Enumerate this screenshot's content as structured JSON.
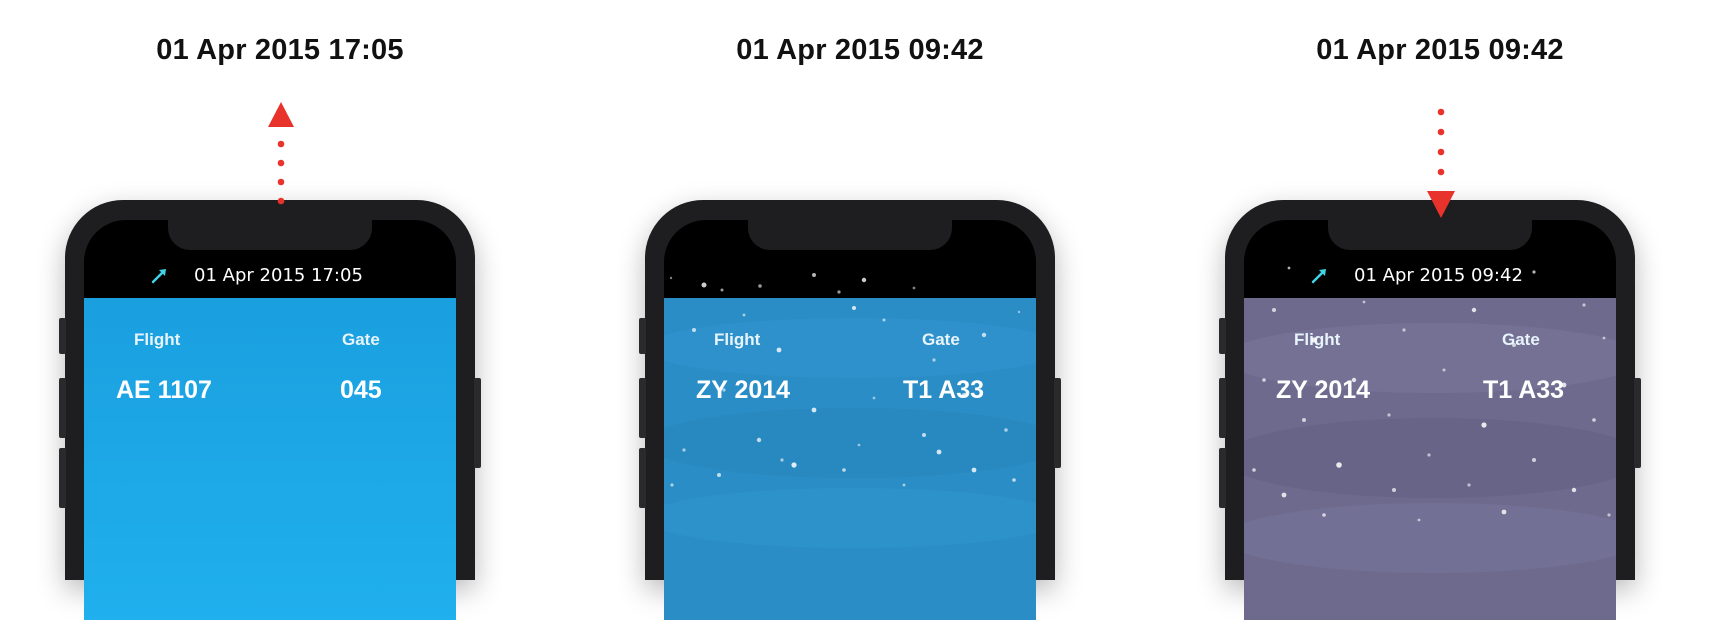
{
  "panels": [
    {
      "caption": "01 Apr 2015 17:05",
      "status_time": "01 Apr 2015 17:05",
      "flight_label": "Flight",
      "gate_label": "Gate",
      "flight_number": "AE 1107",
      "gate_number": "045",
      "background": "#1aa3e3",
      "arrow": "up",
      "plane_icon": "plane-icon"
    },
    {
      "caption": "01 Apr 2015 09:42",
      "status_time": "",
      "flight_label": "Flight",
      "gate_label": "Gate",
      "flight_number": "ZY 2014",
      "gate_number": "T1 A33",
      "background": "#2b8dc5",
      "arrow": "none",
      "weather": "snow"
    },
    {
      "caption": "01 Apr 2015 09:42",
      "status_time": "01 Apr 2015 09:42",
      "flight_label": "Flight",
      "gate_label": "Gate",
      "flight_number": "ZY 2014",
      "gate_number": "T1 A33",
      "background": "#6d6a8e",
      "arrow": "down",
      "weather": "snow",
      "plane_icon": "plane-icon"
    }
  ],
  "colors": {
    "arrow": "#e8332c",
    "plane_icon": "#3fd4e8",
    "phone_frame": "#1e1e20"
  }
}
